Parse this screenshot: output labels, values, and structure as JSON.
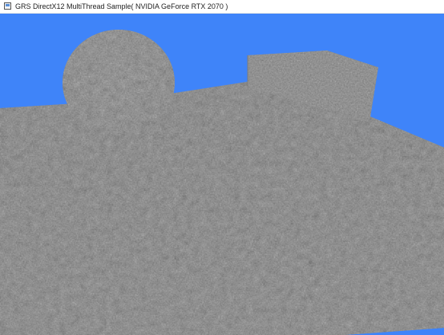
{
  "window": {
    "title": "GRS DirectX12 MultiThread Sample( NVIDIA GeForce RTX 2070 )",
    "icon": "app-window-icon"
  },
  "scene": {
    "sky_color": "#3f84f9",
    "surface_color": "#8c8c8c",
    "objects": [
      "sphere",
      "box",
      "ground-plane"
    ]
  }
}
